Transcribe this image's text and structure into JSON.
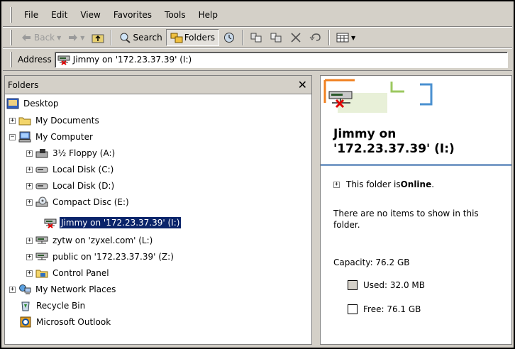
{
  "menu": {
    "items": [
      {
        "label": "File"
      },
      {
        "label": "Edit"
      },
      {
        "label": "View"
      },
      {
        "label": "Favorites"
      },
      {
        "label": "Tools"
      },
      {
        "label": "Help"
      }
    ]
  },
  "toolbar": {
    "back_label": "Back",
    "search_label": "Search",
    "folders_label": "Folders"
  },
  "address": {
    "label": "Address",
    "value": "Jimmy on '172.23.37.39' (I:)"
  },
  "folders": {
    "header": "Folders",
    "tree": [
      {
        "label": "Desktop",
        "icon": "desktop-icon"
      },
      {
        "label": "My Documents",
        "icon": "folder-icon"
      },
      {
        "label": "My Computer",
        "icon": "computer-icon"
      },
      {
        "label": "3½ Floppy (A:)",
        "icon": "floppy-icon"
      },
      {
        "label": "Local Disk (C:)",
        "icon": "disk-icon"
      },
      {
        "label": "Local Disk (D:)",
        "icon": "disk-icon"
      },
      {
        "label": "Compact Disc (E:)",
        "icon": "cd-icon"
      },
      {
        "label": "Jimmy on '172.23.37.39' (I:)",
        "icon": "network-drive-disconnected-icon",
        "selected": true
      },
      {
        "label": "zytw on 'zyxel.com' (L:)",
        "icon": "network-drive-icon"
      },
      {
        "label": "public on '172.23.37.39' (Z:)",
        "icon": "network-drive-icon"
      },
      {
        "label": "Control Panel",
        "icon": "control-panel-icon"
      },
      {
        "label": "My Network Places",
        "icon": "network-places-icon"
      },
      {
        "label": "Recycle Bin",
        "icon": "recycle-bin-icon"
      },
      {
        "label": "Microsoft Outlook",
        "icon": "outlook-icon"
      }
    ]
  },
  "details": {
    "title_line1": "Jimmy on",
    "title_line2": "'172.23.37.39' (I:)",
    "online_prefix": "This folder is ",
    "online_status": "Online",
    "online_suffix": ".",
    "empty_text": "There are no items to show in this folder.",
    "capacity": "Capacity: 76.2 GB",
    "used": "Used: 32.0 MB",
    "free": "Free: 76.1 GB"
  },
  "colors": {
    "selection": "#0a246a",
    "chrome": "#d4d0c8",
    "accent_blue": "#7b9ec8"
  }
}
